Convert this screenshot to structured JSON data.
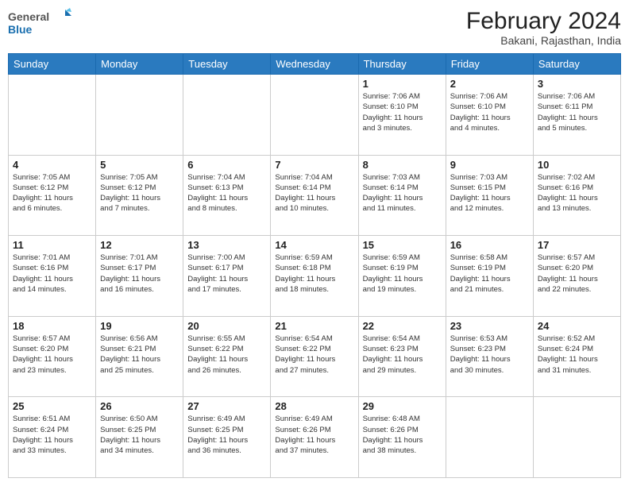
{
  "header": {
    "logo_general": "General",
    "logo_blue": "Blue",
    "month_title": "February 2024",
    "location": "Bakani, Rajasthan, India"
  },
  "weekdays": [
    "Sunday",
    "Monday",
    "Tuesday",
    "Wednesday",
    "Thursday",
    "Friday",
    "Saturday"
  ],
  "weeks": [
    [
      {
        "day": "",
        "info": ""
      },
      {
        "day": "",
        "info": ""
      },
      {
        "day": "",
        "info": ""
      },
      {
        "day": "",
        "info": ""
      },
      {
        "day": "1",
        "info": "Sunrise: 7:06 AM\nSunset: 6:10 PM\nDaylight: 11 hours\nand 3 minutes."
      },
      {
        "day": "2",
        "info": "Sunrise: 7:06 AM\nSunset: 6:10 PM\nDaylight: 11 hours\nand 4 minutes."
      },
      {
        "day": "3",
        "info": "Sunrise: 7:06 AM\nSunset: 6:11 PM\nDaylight: 11 hours\nand 5 minutes."
      }
    ],
    [
      {
        "day": "4",
        "info": "Sunrise: 7:05 AM\nSunset: 6:12 PM\nDaylight: 11 hours\nand 6 minutes."
      },
      {
        "day": "5",
        "info": "Sunrise: 7:05 AM\nSunset: 6:12 PM\nDaylight: 11 hours\nand 7 minutes."
      },
      {
        "day": "6",
        "info": "Sunrise: 7:04 AM\nSunset: 6:13 PM\nDaylight: 11 hours\nand 8 minutes."
      },
      {
        "day": "7",
        "info": "Sunrise: 7:04 AM\nSunset: 6:14 PM\nDaylight: 11 hours\nand 10 minutes."
      },
      {
        "day": "8",
        "info": "Sunrise: 7:03 AM\nSunset: 6:14 PM\nDaylight: 11 hours\nand 11 minutes."
      },
      {
        "day": "9",
        "info": "Sunrise: 7:03 AM\nSunset: 6:15 PM\nDaylight: 11 hours\nand 12 minutes."
      },
      {
        "day": "10",
        "info": "Sunrise: 7:02 AM\nSunset: 6:16 PM\nDaylight: 11 hours\nand 13 minutes."
      }
    ],
    [
      {
        "day": "11",
        "info": "Sunrise: 7:01 AM\nSunset: 6:16 PM\nDaylight: 11 hours\nand 14 minutes."
      },
      {
        "day": "12",
        "info": "Sunrise: 7:01 AM\nSunset: 6:17 PM\nDaylight: 11 hours\nand 16 minutes."
      },
      {
        "day": "13",
        "info": "Sunrise: 7:00 AM\nSunset: 6:17 PM\nDaylight: 11 hours\nand 17 minutes."
      },
      {
        "day": "14",
        "info": "Sunrise: 6:59 AM\nSunset: 6:18 PM\nDaylight: 11 hours\nand 18 minutes."
      },
      {
        "day": "15",
        "info": "Sunrise: 6:59 AM\nSunset: 6:19 PM\nDaylight: 11 hours\nand 19 minutes."
      },
      {
        "day": "16",
        "info": "Sunrise: 6:58 AM\nSunset: 6:19 PM\nDaylight: 11 hours\nand 21 minutes."
      },
      {
        "day": "17",
        "info": "Sunrise: 6:57 AM\nSunset: 6:20 PM\nDaylight: 11 hours\nand 22 minutes."
      }
    ],
    [
      {
        "day": "18",
        "info": "Sunrise: 6:57 AM\nSunset: 6:20 PM\nDaylight: 11 hours\nand 23 minutes."
      },
      {
        "day": "19",
        "info": "Sunrise: 6:56 AM\nSunset: 6:21 PM\nDaylight: 11 hours\nand 25 minutes."
      },
      {
        "day": "20",
        "info": "Sunrise: 6:55 AM\nSunset: 6:22 PM\nDaylight: 11 hours\nand 26 minutes."
      },
      {
        "day": "21",
        "info": "Sunrise: 6:54 AM\nSunset: 6:22 PM\nDaylight: 11 hours\nand 27 minutes."
      },
      {
        "day": "22",
        "info": "Sunrise: 6:54 AM\nSunset: 6:23 PM\nDaylight: 11 hours\nand 29 minutes."
      },
      {
        "day": "23",
        "info": "Sunrise: 6:53 AM\nSunset: 6:23 PM\nDaylight: 11 hours\nand 30 minutes."
      },
      {
        "day": "24",
        "info": "Sunrise: 6:52 AM\nSunset: 6:24 PM\nDaylight: 11 hours\nand 31 minutes."
      }
    ],
    [
      {
        "day": "25",
        "info": "Sunrise: 6:51 AM\nSunset: 6:24 PM\nDaylight: 11 hours\nand 33 minutes."
      },
      {
        "day": "26",
        "info": "Sunrise: 6:50 AM\nSunset: 6:25 PM\nDaylight: 11 hours\nand 34 minutes."
      },
      {
        "day": "27",
        "info": "Sunrise: 6:49 AM\nSunset: 6:25 PM\nDaylight: 11 hours\nand 36 minutes."
      },
      {
        "day": "28",
        "info": "Sunrise: 6:49 AM\nSunset: 6:26 PM\nDaylight: 11 hours\nand 37 minutes."
      },
      {
        "day": "29",
        "info": "Sunrise: 6:48 AM\nSunset: 6:26 PM\nDaylight: 11 hours\nand 38 minutes."
      },
      {
        "day": "",
        "info": ""
      },
      {
        "day": "",
        "info": ""
      }
    ]
  ]
}
